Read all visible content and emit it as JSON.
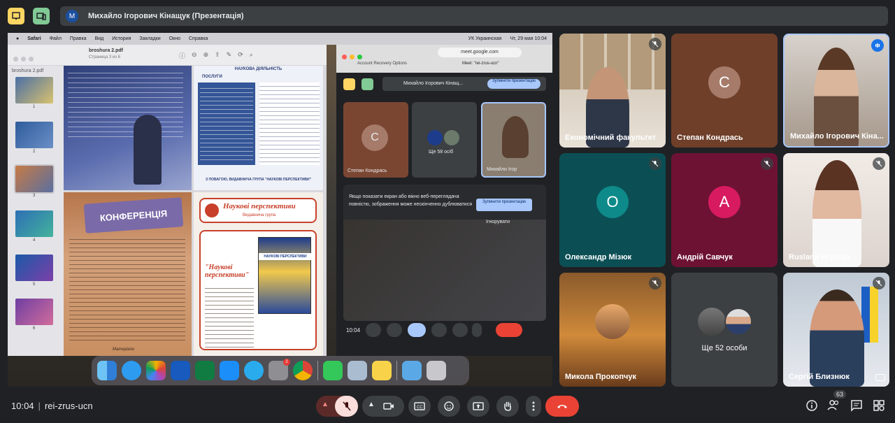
{
  "presenter_bar": {
    "avatar_letter": "M",
    "title": "Михайло Ігорович Кінащук (Презентація)"
  },
  "shared_screen": {
    "mac_menubar": {
      "items": [
        "Safari",
        "Файл",
        "Правка",
        "Вид",
        "История",
        "Закладки",
        "Окно",
        "Справка"
      ],
      "keyboard": "УК Украинская",
      "datetime": "Чт, 29 мая 10:04"
    },
    "preview": {
      "doc_title": "broshura 2.pdf",
      "doc_subtitle": "Страница 3 из 6",
      "sidebar_title": "broshura 2.pdf",
      "thumbnails": [
        "1",
        "2",
        "3",
        "4",
        "5",
        "6"
      ],
      "page_texts": {
        "scientific_activity": "НАУКОВА ДІЯЛЬНІСТЬ",
        "services": "ПОСЛУГИ",
        "regards": "З ПОВАГОЮ, ВИДАВНИЧА ГРУПА \"НАУКОВІ ПЕРСПЕКТИВИ\"",
        "conference": "КОНФЕРЕНЦІЯ",
        "publisher_title": "Наукові перспективи",
        "publisher_subtitle": "Видавнича група",
        "journal_title": "\"Наукові перспективи\"",
        "journal_cover": "НАУКОВІ ПЕРСПЕКТИВИ",
        "materials": "Матеріали"
      }
    },
    "chrome": {
      "url": "meet.google.com",
      "tabs": [
        "Account Recovery Options",
        "Meet: \"rei-zrus-ucn\""
      ],
      "presenter_text": "Михайло Ігорович Кінащ...",
      "stop_button": "Зупинити презентацію",
      "tiles": [
        {
          "name": "Степан Кондрась",
          "letter": "С"
        },
        {
          "name": "Ще 58 осіб"
        },
        {
          "name": "Михайло Ігор"
        }
      ],
      "warning_text": "Якщо показати екран або вікно веб-переглядача повністю, зображення може нескінченно дублюватися",
      "warning_stop": "Зупинити презентацію",
      "warning_ignore": "Ігнорувати",
      "time": "10:04"
    },
    "dock_icons": [
      "finder-icon",
      "safari-icon",
      "photos-icon",
      "word-icon",
      "excel-icon",
      "appstore-icon",
      "telegram-icon",
      "settings-icon",
      "chrome-icon",
      "facetime-icon",
      "preview-icon",
      "notes-icon",
      "downloads-folder-icon",
      "trash-icon"
    ],
    "dock_settings_badge": "2"
  },
  "tiles": [
    {
      "name": "Економічний факультет",
      "type": "video",
      "muted": true
    },
    {
      "name": "Степан Кондрась",
      "type": "avatar",
      "letter": "С",
      "color": "#8a4f34"
    },
    {
      "name": "Михайло Ігорович Кіна...",
      "type": "video",
      "speaking": true
    },
    {
      "name": "Олександр Мізюк",
      "type": "avatar",
      "letter": "О",
      "color": "#0e8a8a",
      "muted": true
    },
    {
      "name": "Андрій Савчук",
      "type": "avatar",
      "letter": "А",
      "color": "#d81b60",
      "muted": true
    },
    {
      "name": "Ruslana Hrytsun",
      "type": "video",
      "muted": true
    },
    {
      "name": "Микола Прокопчук",
      "type": "photo",
      "muted": true
    },
    {
      "name": "Ще 52 особи",
      "type": "group"
    },
    {
      "name": "Сергій Близнюк",
      "type": "video",
      "muted": true
    }
  ],
  "bottom": {
    "time": "10:04",
    "separator": "|",
    "meeting_code": "rei-zrus-ucn",
    "people_count": "63"
  }
}
